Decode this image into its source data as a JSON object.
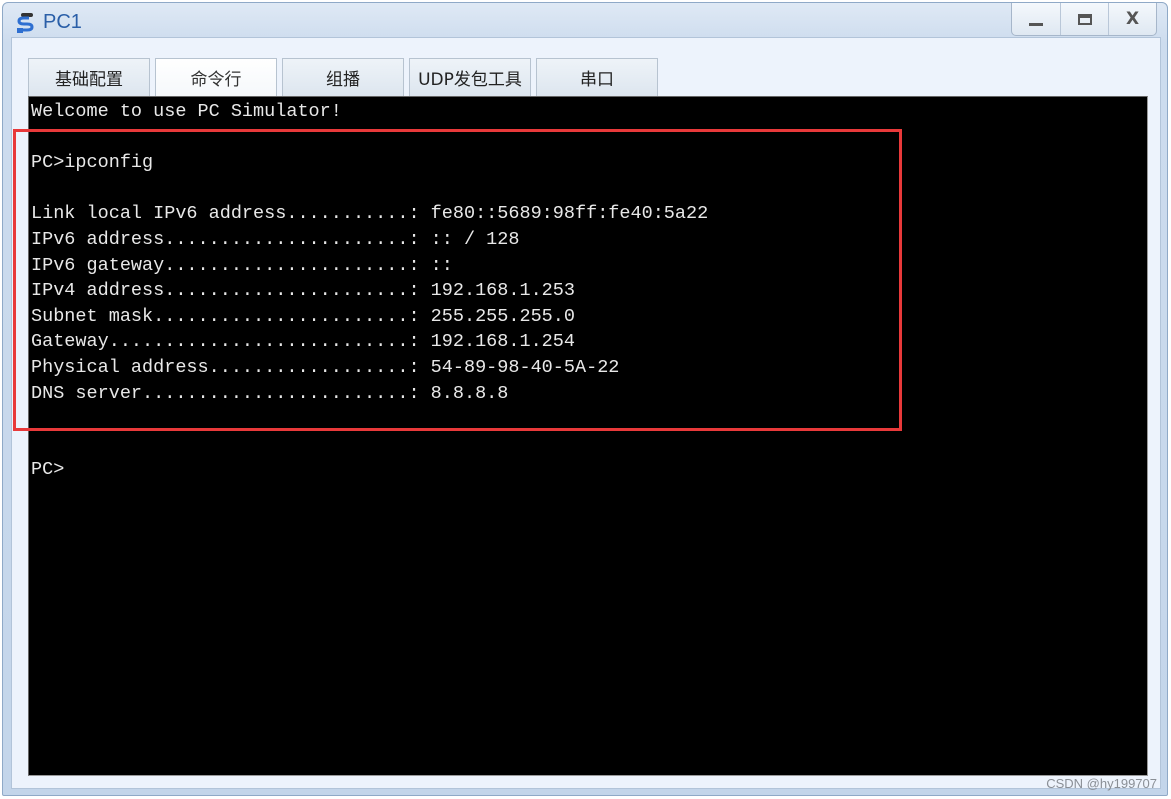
{
  "window": {
    "title": "PC1",
    "icon": "network-pc-icon",
    "controls": {
      "minimize": "minimize-icon",
      "maximize": "maximize-icon",
      "close": "close-icon"
    }
  },
  "tabs": [
    {
      "label": "基础配置",
      "active": false
    },
    {
      "label": "命令行",
      "active": true
    },
    {
      "label": "组播",
      "active": false
    },
    {
      "label": "UDP发包工具",
      "active": false
    },
    {
      "label": "串口",
      "active": false
    }
  ],
  "terminal": {
    "lines": [
      "Welcome to use PC Simulator!",
      "",
      "PC>ipconfig",
      "",
      "Link local IPv6 address...........: fe80::5689:98ff:fe40:5a22",
      "IPv6 address......................: :: / 128",
      "IPv6 gateway......................: ::",
      "IPv4 address......................: 192.168.1.253",
      "Subnet mask.......................: 255.255.255.0",
      "Gateway...........................: 192.168.1.254",
      "Physical address..................: 54-89-98-40-5A-22",
      "DNS server........................: 8.8.8.8",
      "",
      "",
      "PC>"
    ],
    "ipconfig": {
      "link_local_ipv6": "fe80::5689:98ff:fe40:5a22",
      "ipv6_address": ":: / 128",
      "ipv6_gateway": "::",
      "ipv4_address": "192.168.1.253",
      "subnet_mask": "255.255.255.0",
      "gateway": "192.168.1.254",
      "physical_address": "54-89-98-40-5A-22",
      "dns_server": "8.8.8.8"
    }
  },
  "annotation": {
    "color": "#e8393a"
  },
  "watermark": "CSDN @hy199707"
}
